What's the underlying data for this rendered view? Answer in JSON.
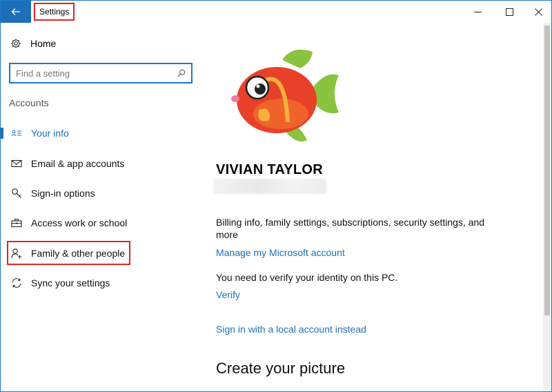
{
  "window": {
    "title": "Settings"
  },
  "sidebar": {
    "home_label": "Home",
    "search_placeholder": "Find a setting",
    "section_heading": "Accounts",
    "items": [
      {
        "label": "Your info",
        "icon": "contact-card-icon",
        "active": true
      },
      {
        "label": "Email & app accounts",
        "icon": "mail-icon",
        "active": false
      },
      {
        "label": "Sign-in options",
        "icon": "key-icon",
        "active": false
      },
      {
        "label": "Access work or school",
        "icon": "briefcase-icon",
        "active": false
      },
      {
        "label": "Family & other people",
        "icon": "add-person-icon",
        "active": false
      },
      {
        "label": "Sync your settings",
        "icon": "sync-icon",
        "active": false
      }
    ]
  },
  "main": {
    "user_name": "VIVIAN TAYLOR",
    "billing_text": "Billing info, family settings, subscriptions, security settings, and more",
    "manage_link": "Manage my Microsoft account",
    "verify_message": "You need to verify your identity on this PC.",
    "verify_link": "Verify",
    "local_account_link": "Sign in with a local account instead",
    "create_picture_heading": "Create your picture"
  },
  "colors": {
    "accent": "#1c6fb8",
    "highlight_box": "#e02424"
  }
}
